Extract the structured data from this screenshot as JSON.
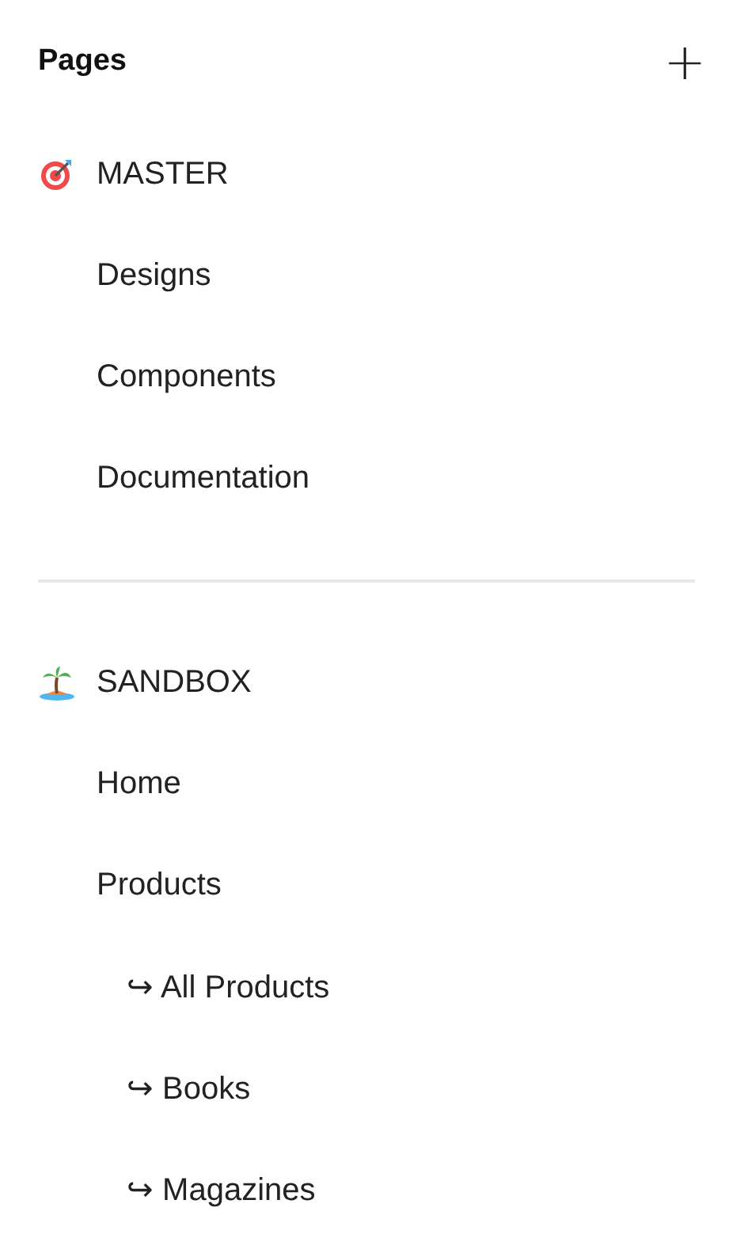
{
  "header": {
    "title": "Pages",
    "add_button": "+"
  },
  "groups": [
    {
      "title": "MASTER",
      "pages": [
        {
          "label": "Designs"
        },
        {
          "label": "Components"
        },
        {
          "label": "Documentation"
        }
      ]
    },
    {
      "title": "SANDBOX",
      "pages": [
        {
          "label": "Home"
        },
        {
          "label": "Products",
          "children": [
            {
              "label": "↪ All Products"
            },
            {
              "label": "↪ Books"
            },
            {
              "label": "↪ Magazines"
            }
          ]
        }
      ]
    }
  ]
}
